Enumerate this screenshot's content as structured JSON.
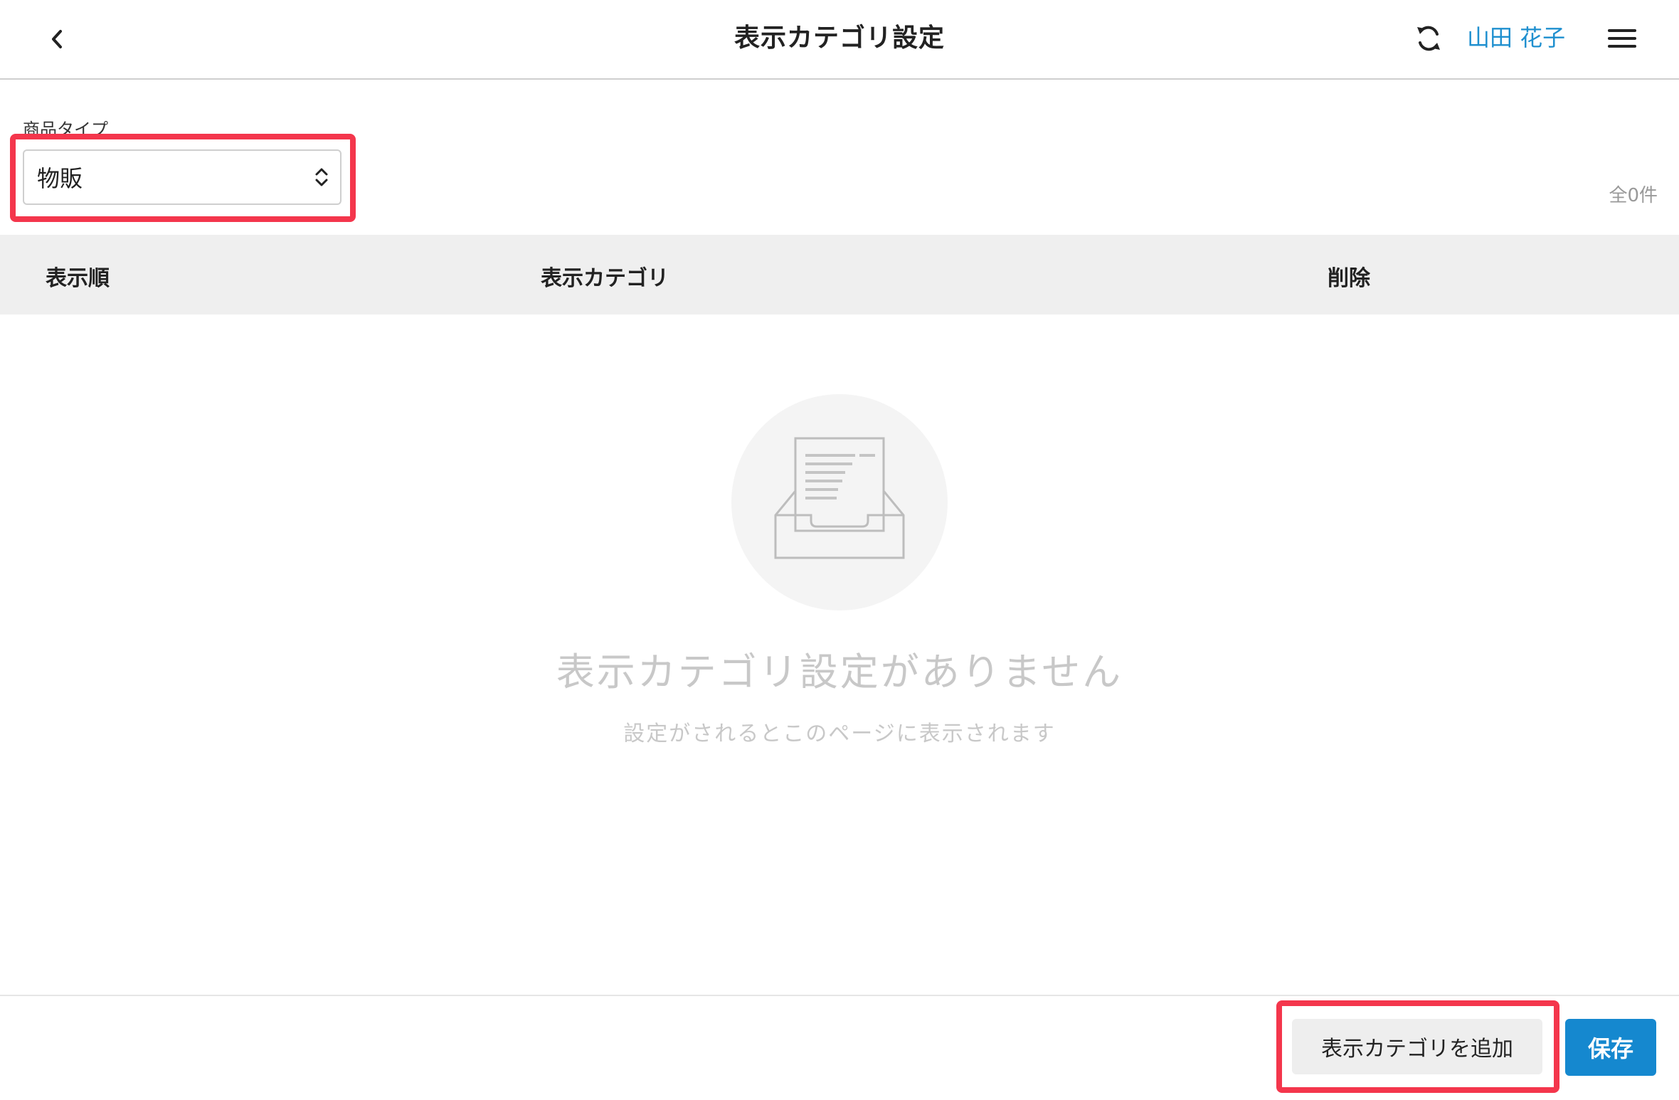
{
  "header": {
    "title": "表示カテゴリ設定",
    "user_name": "山田 花子"
  },
  "filter": {
    "label": "商品タイプ",
    "selected": "物販",
    "total": "全0件"
  },
  "table": {
    "columns": [
      "表示順",
      "表示カテゴリ",
      "削除"
    ]
  },
  "empty_state": {
    "title": "表示カテゴリ設定がありません",
    "subtitle": "設定がされるとこのページに表示されます"
  },
  "footer": {
    "add_label": "表示カテゴリを追加",
    "save_label": "保存"
  },
  "colors": {
    "accent": "#1588cf",
    "highlight": "#f4364c",
    "user_link": "#1e8fcf"
  },
  "icons": [
    "chevron-left-icon",
    "sync-icon",
    "hamburger-menu-icon",
    "select-arrows-icon",
    "empty-inbox-icon"
  ]
}
